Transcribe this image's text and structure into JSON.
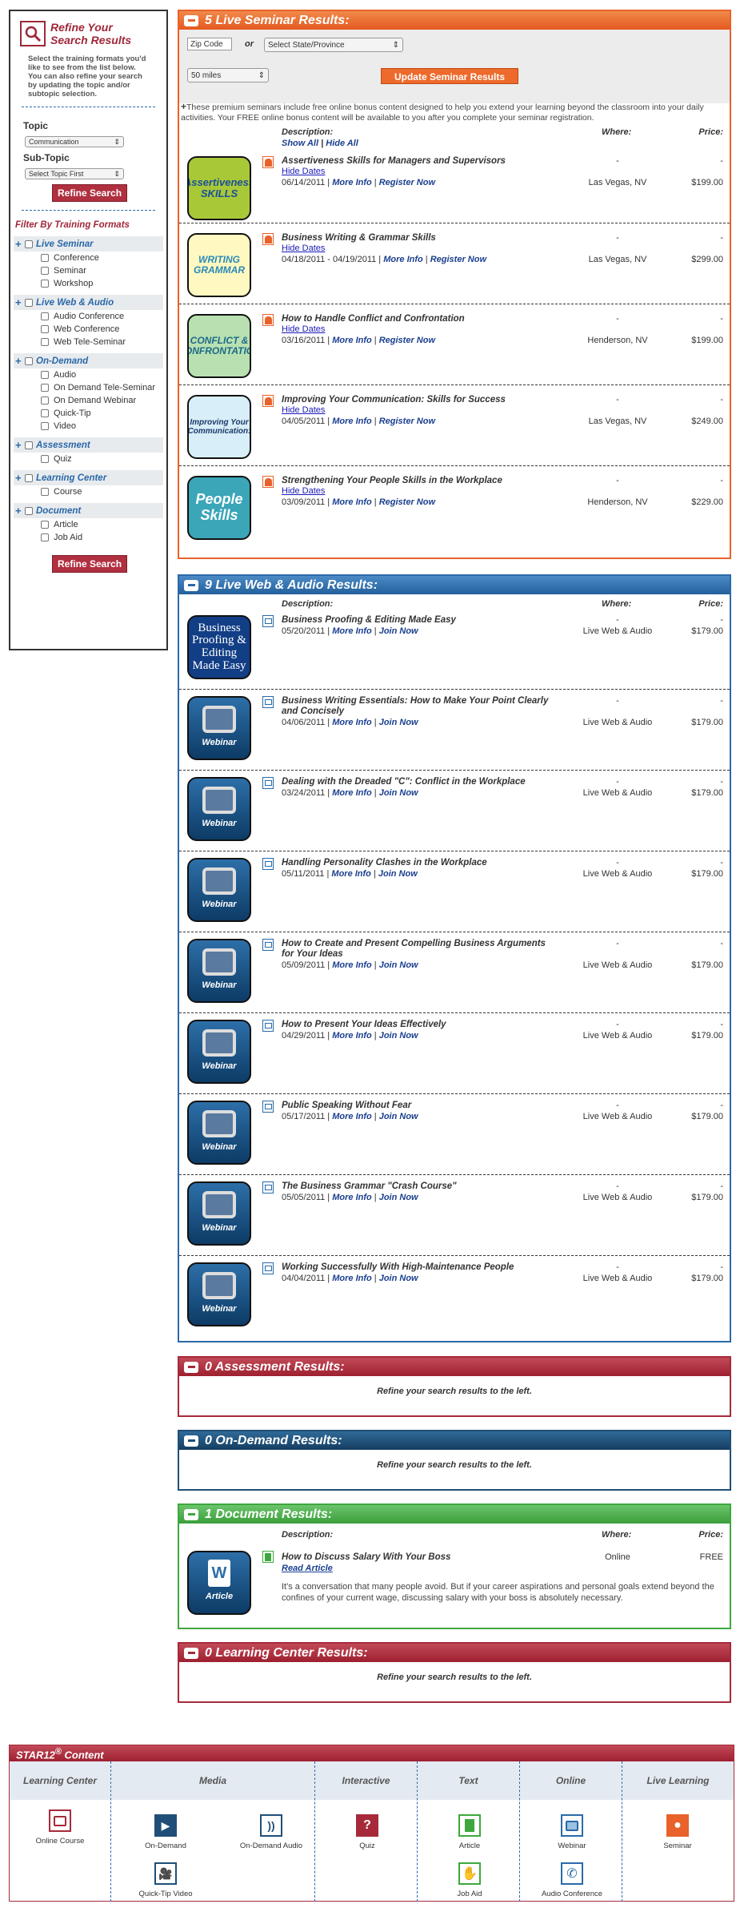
{
  "sidebar": {
    "title_line1": "Refine Your",
    "title_line2": "Search Results",
    "description": "Select the training formats you'd like to see from the list below. You can also refine your search by updating the topic and/or subtopic selection.",
    "topic_label": "Topic",
    "topic_value": "Communication",
    "subtopic_label": "Sub-Topic",
    "subtopic_value": "Select Topic First",
    "refine_button": "Refine Search",
    "filter_title": "Filter By Training Formats",
    "categories": [
      {
        "label": "Live Seminar",
        "options": [
          "Conference",
          "Seminar",
          "Workshop"
        ]
      },
      {
        "label": "Live Web & Audio",
        "options": [
          "Audio Conference",
          "Web Conference",
          "Web Tele-Seminar"
        ]
      },
      {
        "label": "On-Demand",
        "options": [
          "Audio",
          "On Demand Tele-Seminar",
          "On Demand Webinar",
          "Quick-Tip",
          "Video"
        ]
      },
      {
        "label": "Assessment",
        "options": [
          "Quiz"
        ]
      },
      {
        "label": "Learning Center",
        "options": [
          "Course"
        ]
      },
      {
        "label": "Document",
        "options": [
          "Article",
          "Job Aid"
        ]
      }
    ],
    "refine_button_bottom": "Refine Search"
  },
  "seminar": {
    "header": "5 Live Seminar Results:",
    "zip_placeholder": "Zip Code",
    "or": "or",
    "state_value": "Select State/Province",
    "miles_value": "50 miles",
    "update_button": "Update Seminar Results",
    "bonus_text": "These premium seminars include free online bonus content designed to help you extend your learning beyond the classroom into your daily activities. Your FREE online bonus content will be available to you after you complete your seminar registration.",
    "col_description": "Description:",
    "col_where": "Where:",
    "col_price": "Price:",
    "show_all": "Show All",
    "hide_all": "Hide All",
    "sep": "|",
    "items": [
      {
        "title": "Assertiveness Skills for Managers and Supervisors",
        "hide": "Hide Dates",
        "date": "06/14/2011",
        "more": "More Info",
        "register": "Register Now",
        "where": "Las Vegas, NV",
        "price": "$199.00",
        "dash": "-",
        "thumb": "Assertiveness SKILLS"
      },
      {
        "title": "Business Writing & Grammar Skills",
        "hide": "Hide Dates",
        "date": "04/18/2011 - 04/19/2011",
        "more": "More Info",
        "register": "Register Now",
        "where": "Las Vegas, NV",
        "price": "$299.00",
        "dash": "-",
        "thumb": "WRITING GRAMMAR"
      },
      {
        "title": "How to Handle Conflict and Confrontation",
        "hide": "Hide Dates",
        "date": "03/16/2011",
        "more": "More Info",
        "register": "Register Now",
        "where": "Henderson, NV",
        "price": "$199.00",
        "dash": "-",
        "thumb": "CONFLICT & CONFRONTATION"
      },
      {
        "title": "Improving Your Communication: Skills for Success",
        "hide": "Hide Dates",
        "date": "04/05/2011",
        "more": "More Info",
        "register": "Register Now",
        "where": "Las Vegas, NV",
        "price": "$249.00",
        "dash": "-",
        "thumb": "Improving Your Communication:"
      },
      {
        "title": "Strengthening Your People Skills in the Workplace",
        "hide": "Hide Dates",
        "date": "03/09/2011",
        "more": "More Info",
        "register": "Register Now",
        "where": "Henderson, NV",
        "price": "$229.00",
        "dash": "-",
        "thumb": "People Skills"
      }
    ]
  },
  "web": {
    "header": "9 Live Web & Audio Results:",
    "col_description": "Description:",
    "col_where": "Where:",
    "col_price": "Price:",
    "thumb_label": "Webinar",
    "first_thumb": "Business Proofing & Editing Made Easy",
    "items": [
      {
        "title": "Business Proofing & Editing Made Easy",
        "date": "05/20/2011",
        "more": "More Info",
        "join": "Join Now",
        "where": "Live Web & Audio",
        "price": "$179.00",
        "dash": "-"
      },
      {
        "title": "Business Writing Essentials: How to Make Your Point Clearly and Concisely",
        "date": "04/06/2011",
        "more": "More Info",
        "join": "Join Now",
        "where": "Live Web & Audio",
        "price": "$179.00",
        "dash": "-"
      },
      {
        "title": "Dealing with the Dreaded \"C\": Conflict in the Workplace",
        "date": "03/24/2011",
        "more": "More Info",
        "join": "Join Now",
        "where": "Live Web & Audio",
        "price": "$179.00",
        "dash": "-"
      },
      {
        "title": "Handling Personality Clashes in the Workplace",
        "date": "05/11/2011",
        "more": "More Info",
        "join": "Join Now",
        "where": "Live Web & Audio",
        "price": "$179.00",
        "dash": "-"
      },
      {
        "title": "How to Create and Present Compelling Business Arguments for Your Ideas",
        "date": "05/09/2011",
        "more": "More Info",
        "join": "Join Now",
        "where": "Live Web & Audio",
        "price": "$179.00",
        "dash": "-"
      },
      {
        "title": "How to Present Your Ideas Effectively",
        "date": "04/29/2011",
        "more": "More Info",
        "join": "Join Now",
        "where": "Live Web & Audio",
        "price": "$179.00",
        "dash": "-"
      },
      {
        "title": "Public Speaking Without Fear",
        "date": "05/17/2011",
        "more": "More Info",
        "join": "Join Now",
        "where": "Live Web & Audio",
        "price": "$179.00",
        "dash": "-"
      },
      {
        "title": "The Business Grammar \"Crash Course\"",
        "date": "05/05/2011",
        "more": "More Info",
        "join": "Join Now",
        "where": "Live Web & Audio",
        "price": "$179.00",
        "dash": "-"
      },
      {
        "title": "Working Successfully With High-Maintenance People",
        "date": "04/04/2011",
        "more": "More Info",
        "join": "Join Now",
        "where": "Live Web & Audio",
        "price": "$179.00",
        "dash": "-"
      }
    ]
  },
  "assessment": {
    "header": "0 Assessment Results:",
    "message": "Refine your search results to the left."
  },
  "ondemand": {
    "header": "0 On-Demand Results:",
    "message": "Refine your search results to the left."
  },
  "document": {
    "header": "1 Document Results:",
    "col_description": "Description:",
    "col_where": "Where:",
    "col_price": "Price:",
    "title": "How to Discuss Salary With Your Boss",
    "read": "Read Article",
    "where": "Online",
    "price": "FREE",
    "summary": "It's a conversation that many people avoid. But if your career aspirations and personal goals extend beyond the confines of your current wage, discussing salary with your boss is absolutely necessary.",
    "thumb_label": "Article"
  },
  "learning": {
    "header": "0 Learning Center Results:",
    "message": "Refine your search results to the left."
  },
  "star12": {
    "title": "STAR12",
    "reg": "®",
    "title_suffix": " Content",
    "columns": {
      "learning_center": "Learning Center",
      "media": "Media",
      "interactive": "Interactive",
      "text": "Text",
      "online": "Online",
      "live_learning": "Live Learning"
    },
    "icons": {
      "online_course": "Online Course",
      "on_demand": "On-Demand",
      "on_demand_audio": "On-Demand Audio",
      "quick_tip_video": "Quick-Tip Video",
      "quiz": "Quiz",
      "article": "Article",
      "job_aid": "Job Aid",
      "webinar": "Webinar",
      "audio_conference": "Audio Conference",
      "seminar": "Seminar"
    }
  },
  "colors": {
    "orange": "#e8622a",
    "blue": "#2a6aa8",
    "crimson": "#a62a3a",
    "green": "#3ea83e",
    "navy": "#1f4f78"
  }
}
